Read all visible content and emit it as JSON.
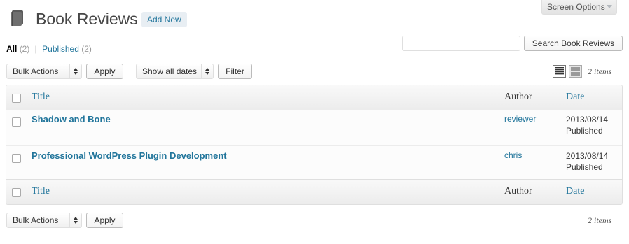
{
  "screen_options": {
    "label": "Screen Options"
  },
  "header": {
    "title": "Book Reviews",
    "add_new_label": "Add New"
  },
  "views": [
    {
      "label": "All",
      "count": "(2)"
    },
    {
      "label": "Published",
      "count": "(2)"
    }
  ],
  "views_separator": "|",
  "search": {
    "placeholder": "",
    "button_label": "Search Book Reviews"
  },
  "top_nav": {
    "bulk_actions": "Bulk Actions",
    "apply_label": "Apply",
    "dates_filter": "Show all dates",
    "filter_label": "Filter",
    "items_count": "2 items"
  },
  "table": {
    "columns": {
      "title": "Title",
      "author": "Author",
      "date": "Date"
    },
    "rows": [
      {
        "title": "Shadow and Bone",
        "author": "reviewer",
        "date": "2013/08/14",
        "status": "Published"
      },
      {
        "title": "Professional WordPress Plugin Development",
        "author": "chris",
        "date": "2013/08/14",
        "status": "Published"
      }
    ]
  },
  "bottom_nav": {
    "bulk_actions": "Bulk Actions",
    "apply_label": "Apply",
    "items_count": "2 items"
  },
  "colors": {
    "link": "#21759b",
    "title_text": "#464646",
    "border": "#dfdfdf"
  },
  "icons": [
    "book-icon",
    "list-view-icon",
    "excerpt-view-icon",
    "select-arrows-icon",
    "screen-options-caret-icon"
  ]
}
